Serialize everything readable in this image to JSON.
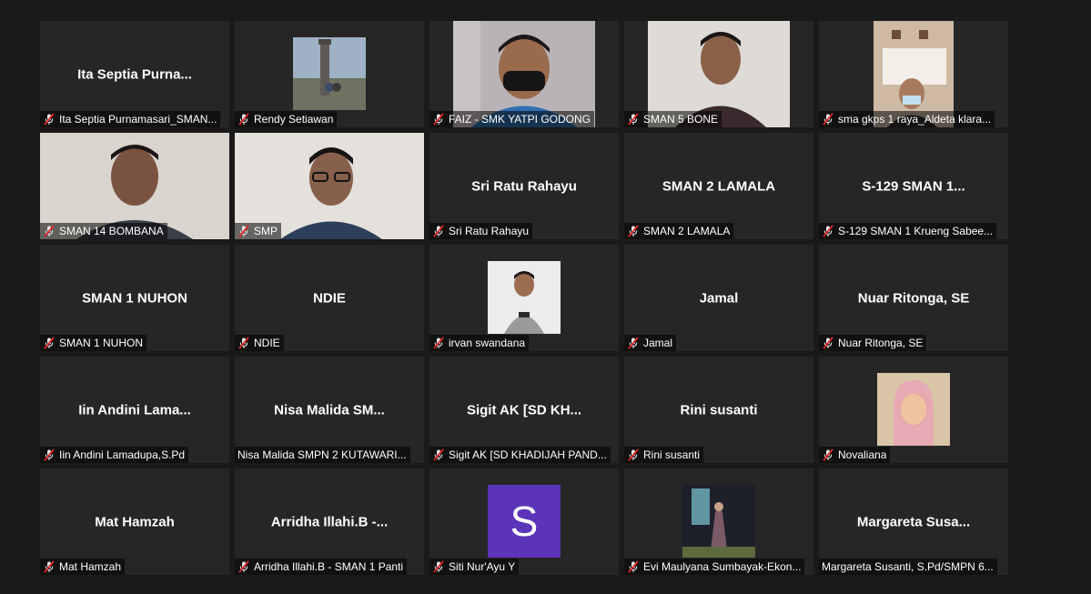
{
  "participants": [
    {
      "display": "Ita  Septia  Purna...",
      "label": "Ita Septia Purnamasari_SMAN..."
    },
    {
      "display": "",
      "label": "Rendy Setiawan"
    },
    {
      "display": "",
      "label": "FAIZ - SMK YATPI GODONG"
    },
    {
      "display": "",
      "label": "SMAN 5 BONE"
    },
    {
      "display": "",
      "label": "sma gkps 1 raya_Aldeta klara..."
    },
    {
      "display": "",
      "label": "SMAN 14 BOMBANA"
    },
    {
      "display": "",
      "label": "SMP"
    },
    {
      "display": "Sri Ratu Rahayu",
      "label": "Sri Ratu Rahayu"
    },
    {
      "display": "SMAN 2 LAMALA",
      "label": "SMAN 2 LAMALA"
    },
    {
      "display": "S-129  SMAN 1...",
      "label": "S-129 SMAN 1 Krueng Sabee..."
    },
    {
      "display": "SMAN 1 NUHON",
      "label": "SMAN 1 NUHON"
    },
    {
      "display": "NDIE",
      "label": "NDIE"
    },
    {
      "display": "",
      "label": "irvan swandana"
    },
    {
      "display": "Jamal",
      "label": "Jamal"
    },
    {
      "display": "Nuar Ritonga, SE",
      "label": "Nuar Ritonga, SE"
    },
    {
      "display": "Iin  Andini  Lama...",
      "label": "Iin Andini Lamadupa,S.Pd"
    },
    {
      "display": "Nisa  Malida  SM...",
      "label": "Nisa Malida SMPN 2 KUTAWARI..."
    },
    {
      "display": "Sigit  AK  [SD  KH...",
      "label": "Sigit AK [SD KHADIJAH PAND..."
    },
    {
      "display": "Rini susanti",
      "label": "Rini susanti"
    },
    {
      "display": "",
      "label": "Novaliana"
    },
    {
      "display": "Mat Hamzah",
      "label": "Mat Hamzah"
    },
    {
      "display": "Arridha  Illahi.B  -...",
      "label": "Arridha Illahi.B - SMAN 1 Panti"
    },
    {
      "display": "",
      "label": "Siti Nur'Ayu Y",
      "avatar_letter": "S"
    },
    {
      "display": "",
      "label": "Evi Maulyana Sumbayak-Ekon..."
    },
    {
      "display": "Margareta  Susa...",
      "label": "Margareta Susanti, S.Pd/SMPN 6..."
    }
  ],
  "colors": {
    "tile_bg": "#262626",
    "page_bg": "#1a1a1a",
    "mute_red": "#e02828",
    "avatar_purple": "#5b34b8"
  }
}
